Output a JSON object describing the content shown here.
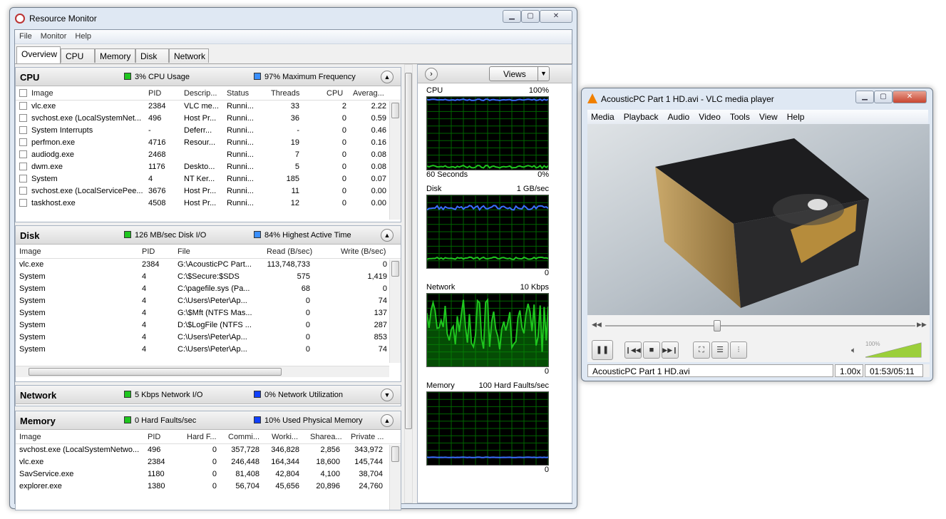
{
  "resmon": {
    "title": "Resource Monitor",
    "menu": [
      "File",
      "Monitor",
      "Help"
    ],
    "tabs": [
      "Overview",
      "CPU",
      "Memory",
      "Disk",
      "Network"
    ],
    "cpu": {
      "name": "CPU",
      "ind1": "3% CPU Usage",
      "ind2": "97% Maximum Frequency",
      "cols": [
        "Image",
        "PID",
        "Descrip...",
        "Status",
        "Threads",
        "CPU",
        "Averag..."
      ],
      "rows": [
        [
          "vlc.exe",
          "2384",
          "VLC me...",
          "Runni...",
          "33",
          "2",
          "2.22"
        ],
        [
          "svchost.exe (LocalSystemNet...",
          "496",
          "Host Pr...",
          "Runni...",
          "36",
          "0",
          "0.59"
        ],
        [
          "System Interrupts",
          "-",
          "Deferr...",
          "Runni...",
          "-",
          "0",
          "0.46"
        ],
        [
          "perfmon.exe",
          "4716",
          "Resour...",
          "Runni...",
          "19",
          "0",
          "0.16"
        ],
        [
          "audiodg.exe",
          "2468",
          "",
          "Runni...",
          "7",
          "0",
          "0.08"
        ],
        [
          "dwm.exe",
          "1176",
          "Deskto...",
          "Runni...",
          "5",
          "0",
          "0.08"
        ],
        [
          "System",
          "4",
          "NT Ker...",
          "Runni...",
          "185",
          "0",
          "0.07"
        ],
        [
          "svchost.exe (LocalServicePee...",
          "3676",
          "Host Pr...",
          "Runni...",
          "11",
          "0",
          "0.00"
        ],
        [
          "taskhost.exe",
          "4508",
          "Host Pr...",
          "Runni...",
          "12",
          "0",
          "0.00"
        ]
      ]
    },
    "disk": {
      "name": "Disk",
      "ind1": "126 MB/sec Disk I/O",
      "ind2": "84% Highest Active Time",
      "cols": [
        "Image",
        "PID",
        "File",
        "Read (B/sec)",
        "Write (B/sec)"
      ],
      "rows": [
        [
          "vlc.exe",
          "2384",
          "G:\\AcousticPC Part...",
          "113,748,733",
          "0"
        ],
        [
          "System",
          "4",
          "C:\\$Secure:$SDS",
          "575",
          "1,419"
        ],
        [
          "System",
          "4",
          "C:\\pagefile.sys (Pa...",
          "68",
          "0"
        ],
        [
          "System",
          "4",
          "C:\\Users\\Peter\\Ap...",
          "0",
          "74"
        ],
        [
          "System",
          "4",
          "G:\\$Mft (NTFS Mas...",
          "0",
          "137"
        ],
        [
          "System",
          "4",
          "D:\\$LogFile (NTFS ...",
          "0",
          "287"
        ],
        [
          "System",
          "4",
          "C:\\Users\\Peter\\Ap...",
          "0",
          "853"
        ],
        [
          "System",
          "4",
          "C:\\Users\\Peter\\Ap...",
          "0",
          "74"
        ]
      ]
    },
    "network": {
      "name": "Network",
      "ind1": "5 Kbps Network I/O",
      "ind2": "0% Network Utilization"
    },
    "memory": {
      "name": "Memory",
      "ind1": "0 Hard Faults/sec",
      "ind2": "10% Used Physical Memory",
      "cols": [
        "Image",
        "PID",
        "Hard F...",
        "Commi...",
        "Worki...",
        "Sharea...",
        "Private ..."
      ],
      "rows": [
        [
          "svchost.exe (LocalSystemNetwo...",
          "496",
          "0",
          "357,728",
          "346,828",
          "2,856",
          "343,972"
        ],
        [
          "vlc.exe",
          "2384",
          "0",
          "246,448",
          "164,344",
          "18,600",
          "145,744"
        ],
        [
          "SavService.exe",
          "1180",
          "0",
          "81,408",
          "42,804",
          "4,100",
          "38,704"
        ],
        [
          "explorer.exe",
          "1380",
          "0",
          "56,704",
          "45,656",
          "20,896",
          "24,760"
        ]
      ]
    },
    "views_label": "Views",
    "graphs": [
      {
        "name": "CPU",
        "max": "100%",
        "foot_left": "60 Seconds",
        "foot_right": "0%"
      },
      {
        "name": "Disk",
        "max": "1 GB/sec",
        "foot_left": "",
        "foot_right": "0"
      },
      {
        "name": "Network",
        "max": "10 Kbps",
        "foot_left": "",
        "foot_right": "0"
      },
      {
        "name": "Memory",
        "max": "100 Hard Faults/sec",
        "foot_left": "",
        "foot_right": "0"
      }
    ]
  },
  "vlc": {
    "title": "AcousticPC Part 1 HD.avi - VLC media player",
    "menu": [
      "Media",
      "Playback",
      "Audio",
      "Video",
      "Tools",
      "View",
      "Help"
    ],
    "volume": "100%",
    "status_file": "AcousticPC Part 1 HD.avi",
    "speed": "1.00x",
    "time": "01:53/05:11",
    "seek_fraction": 0.36,
    "volume_fraction": 1.0,
    "icons": [
      "pause-icon",
      "previous-icon",
      "stop-icon",
      "next-icon",
      "fullscreen-icon",
      "playlist-icon",
      "extended-settings-icon",
      "speaker-icon"
    ]
  },
  "colors": {
    "cpu_green": "#1fc61f",
    "cpu_blue": "#3a6fff",
    "graph_bg": "#000000",
    "grid": "#006400"
  }
}
